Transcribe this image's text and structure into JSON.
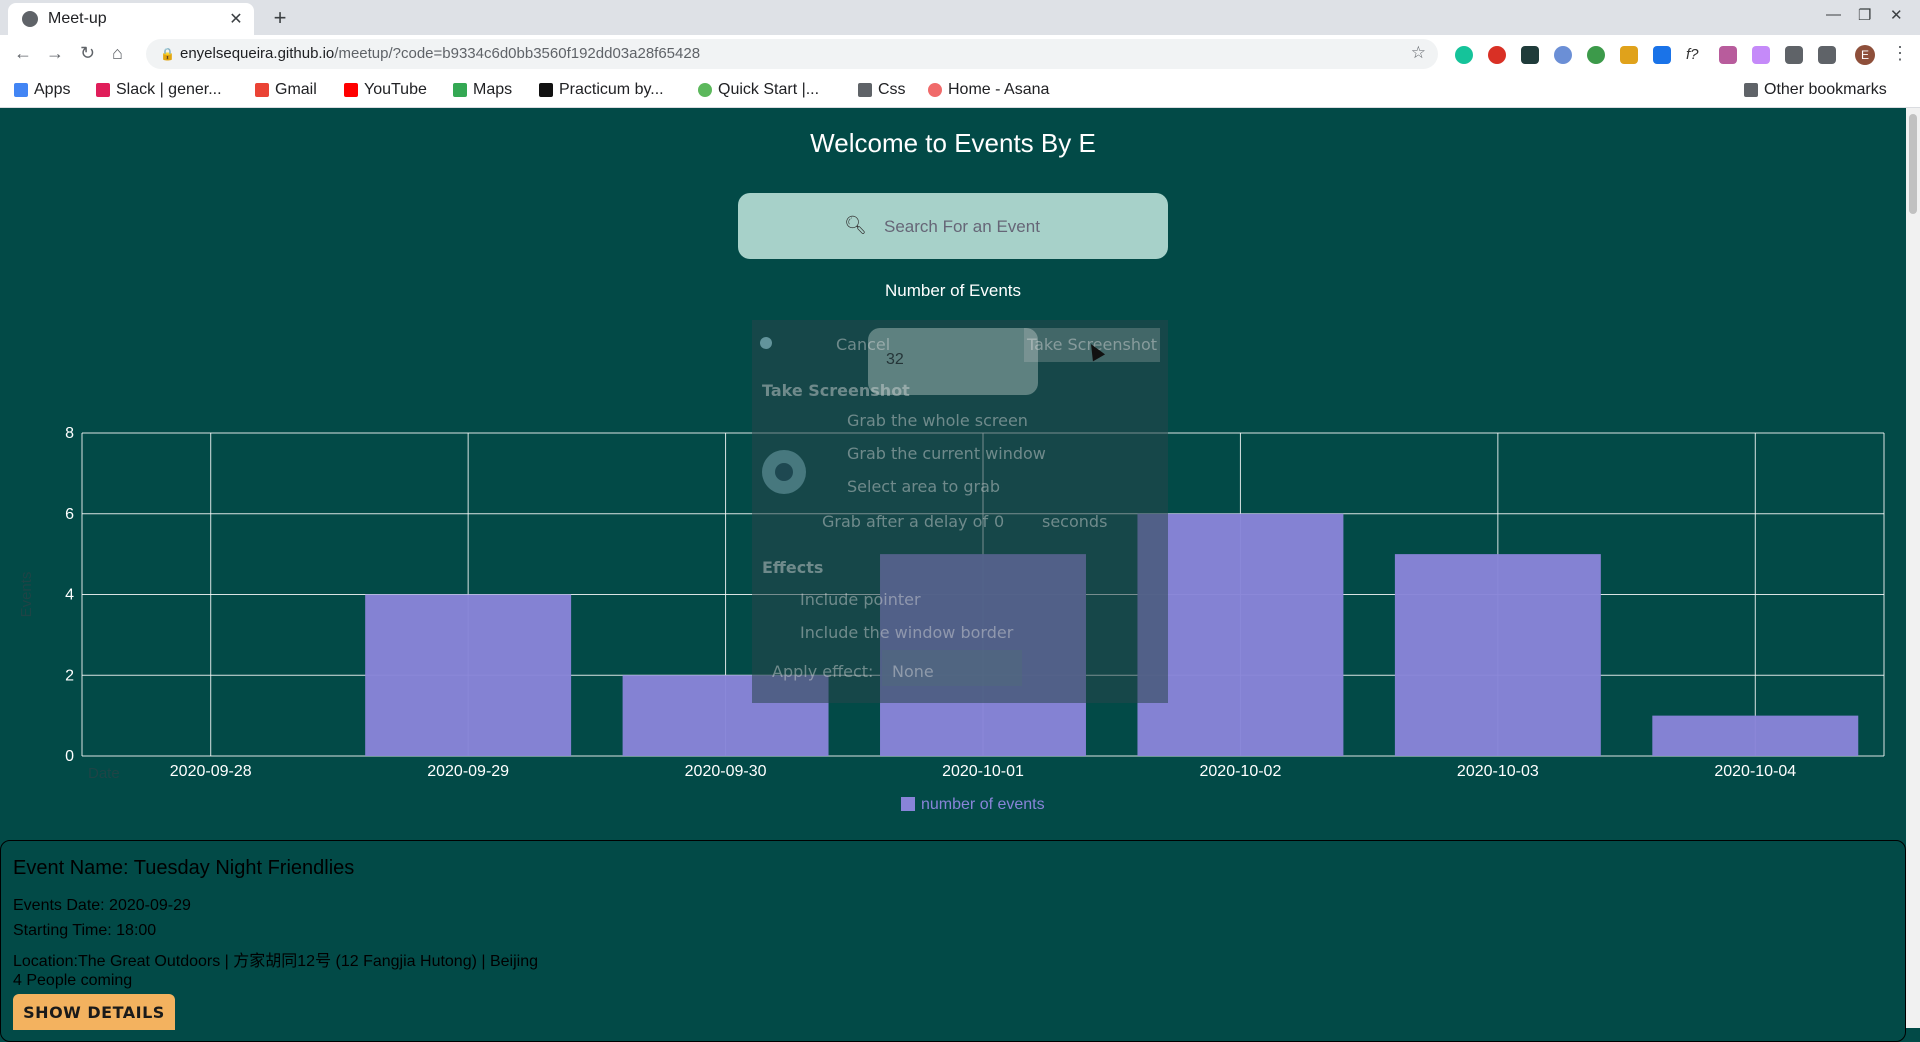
{
  "browser": {
    "tab_title": "Meet-up",
    "url_host": "enyelsequeira.github.io",
    "url_path": "/meetup/?code=b9334c6d0bb3560f192dd03a28f65428",
    "bookmarks": [
      "Apps",
      "Slack | gener...",
      "Gmail",
      "YouTube",
      "Maps",
      "Practicum by...",
      "Quick Start |...",
      "Css",
      "Home - Asana"
    ],
    "other_bookmarks": "Other bookmarks",
    "avatar_letter": "E"
  },
  "page": {
    "welcome": "Welcome to Events By E",
    "search_placeholder": "Search For an Event",
    "number_label": "Number of Events",
    "number_value": "32"
  },
  "dialog": {
    "cancel": "Cancel",
    "take_screenshot_button": "Take Screenshot",
    "heading": "Take Screenshot",
    "options": [
      "Grab the whole screen",
      "Grab the current window",
      "Select area to grab"
    ],
    "delay_label": "Grab after a delay of",
    "delay_value": "0",
    "delay_unit": "seconds",
    "effects_heading": "Effects",
    "include_pointer": "Include pointer",
    "include_border": "Include the window border",
    "apply_effect_label": "Apply effect:",
    "apply_effect_value": "None"
  },
  "chart_data": {
    "type": "bar",
    "categories": [
      "2020-09-28",
      "2020-09-29",
      "2020-09-30",
      "2020-10-01",
      "2020-10-02",
      "2020-10-03",
      "2020-10-04"
    ],
    "series": [
      {
        "name": "number of events",
        "values": [
          0,
          4,
          2,
          5,
          6,
          5,
          1
        ]
      }
    ],
    "xlabel": "Date",
    "ylabel": "Events",
    "ylim": [
      0,
      8
    ],
    "yticks": [
      0,
      2,
      4,
      6,
      8
    ],
    "grid": true,
    "legend": "bottom-center",
    "bar_color": "#8884d8"
  },
  "event": {
    "name": "Event Name: Tuesday Night Friendlies",
    "date": "Events Date: 2020-09-29",
    "time": "Starting Time: 18:00",
    "location": "Location:The Great Outdoors | 方家胡同12号 (12 Fangjia Hutong) | Beijing",
    "coming": "4 People coming",
    "details_button": "SHOW DETAILS"
  }
}
